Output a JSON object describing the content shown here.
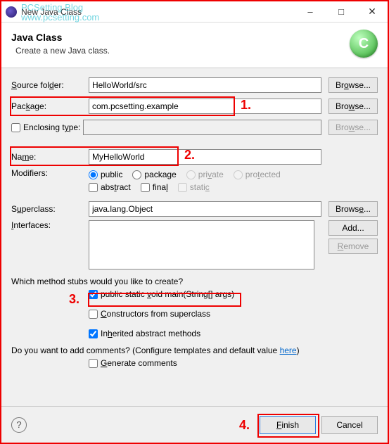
{
  "window": {
    "title": "New Java Class"
  },
  "watermark": {
    "line1": "PCSetting Blog",
    "line2": "www.pcsetting.com"
  },
  "banner": {
    "title": "Java Class",
    "subtitle": "Create a new Java class.",
    "icon_letter": "C"
  },
  "labels": {
    "source_folder": "Source folder:",
    "package": "Package:",
    "enclosing_type": "Enclosing type:",
    "name": "Name:",
    "modifiers": "Modifiers:",
    "superclass": "Superclass:",
    "interfaces": "Interfaces:"
  },
  "fields": {
    "source_folder": "HelloWorld/src",
    "package": "com.pcsetting.example",
    "enclosing_type": "",
    "name": "MyHelloWorld",
    "superclass": "java.lang.Object"
  },
  "buttons": {
    "browse": "Browse...",
    "add": "Add...",
    "remove": "Remove",
    "finish": "Finish",
    "cancel": "Cancel"
  },
  "modifiers": {
    "public": "public",
    "package": "package",
    "private": "private",
    "protected": "protected",
    "abstract": "abstract",
    "final": "final",
    "static": "static"
  },
  "stubs": {
    "question": "Which method stubs would you like to create?",
    "main": "public static void main(String[] args)",
    "constructors": "Constructors from superclass",
    "inherited": "Inherited abstract methods"
  },
  "comments": {
    "question_prefix": "Do you want to add comments? (Configure templates and default value ",
    "link": "here",
    "question_suffix": ")",
    "generate": "Generate comments"
  },
  "annotations": {
    "a1": "1.",
    "a2": "2.",
    "a3": "3.",
    "a4": "4."
  }
}
